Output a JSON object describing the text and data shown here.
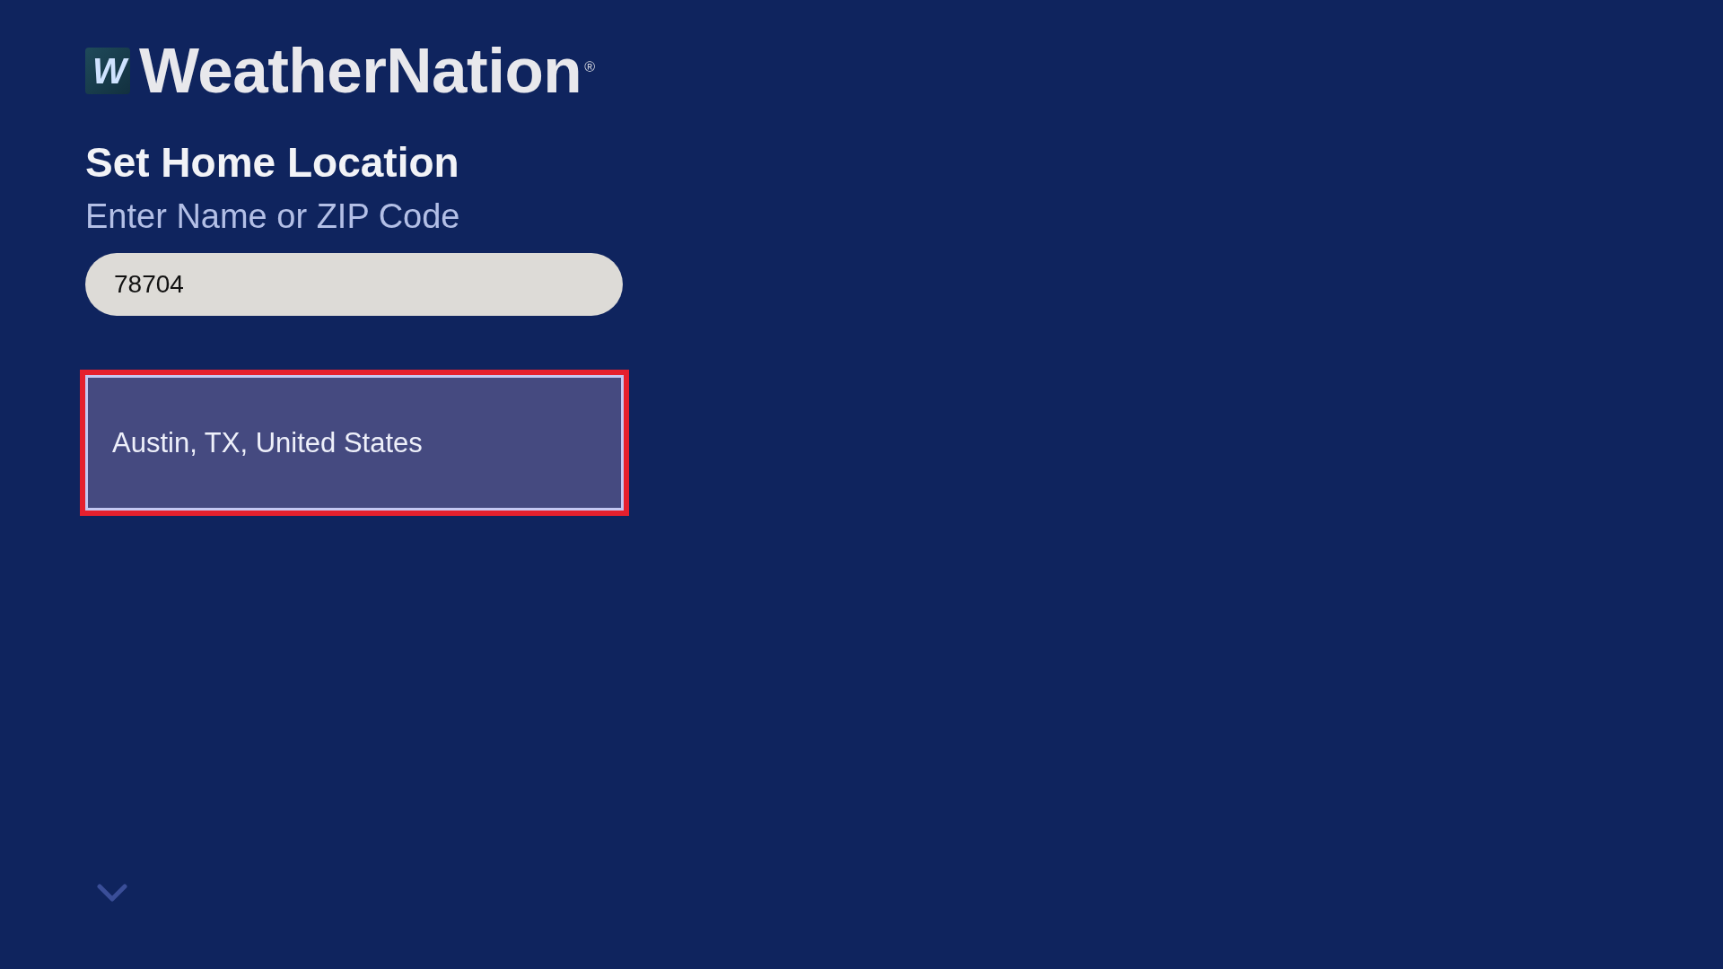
{
  "logo": {
    "mark": "W",
    "wordmark": "WeatherNation$^{®}$"
  },
  "heading": "Set Home Location",
  "search": {
    "label": "Enter Name or ZIP Code",
    "value": "78704"
  },
  "results": [
    {
      "label": "Austin, TX, United States",
      "selected": true
    }
  ]
}
